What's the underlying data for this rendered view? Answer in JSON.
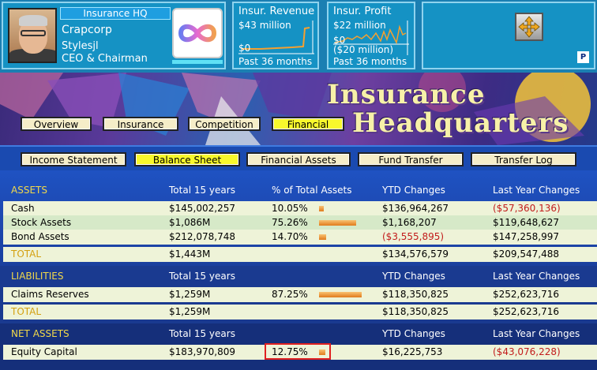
{
  "header": {
    "hq_label": "Insurance HQ",
    "company_name": "Crapcorp",
    "user_name": "Stylesjl",
    "user_title": "CEO & Chairman"
  },
  "revenue_graph": {
    "title": "Insur. Revenue",
    "top_value": "$43 million",
    "bottom_value": "$0",
    "footer": "Past 36 months"
  },
  "profit_graph": {
    "title": "Insur. Profit",
    "top_value": "$22 million",
    "mid_value": "$0",
    "bottom_value": "($20 million)",
    "footer": "Past 36 months"
  },
  "tools": {
    "badge": "P"
  },
  "banner": {
    "title_line1": "Insurance",
    "title_line2": "Headquarters"
  },
  "nav_tabs": [
    {
      "label": "Overview",
      "active": false
    },
    {
      "label": "Insurance",
      "active": false
    },
    {
      "label": "Competition",
      "active": false
    },
    {
      "label": "Financial",
      "active": true
    }
  ],
  "sub_tabs": [
    {
      "label": "Income Statement",
      "active": false
    },
    {
      "label": "Balance Sheet",
      "active": true
    },
    {
      "label": "Financial Assets",
      "active": false
    },
    {
      "label": "Fund Transfer",
      "active": false
    },
    {
      "label": "Transfer Log",
      "active": false
    }
  ],
  "assets": {
    "header": [
      "ASSETS",
      "Total 15 years",
      "% of Total Assets",
      "YTD Changes",
      "Last Year Changes"
    ],
    "rows": [
      {
        "name": "Cash",
        "total": "$145,002,257",
        "pct": "10.05%",
        "pct_value": 10.05,
        "ytd": "$136,964,267",
        "last": "($57,360,136)"
      },
      {
        "name": "Stock Assets",
        "total": "$1,086M",
        "pct": "75.26%",
        "pct_value": 75.26,
        "ytd": "$1,168,207",
        "last": "$119,648,627"
      },
      {
        "name": "Bond Assets",
        "total": "$212,078,748",
        "pct": "14.70%",
        "pct_value": 14.7,
        "ytd": "($3,555,895)",
        "last": "$147,258,997"
      }
    ],
    "total": {
      "name": "TOTAL",
      "total": "$1,443M",
      "ytd": "$134,576,579",
      "last": "$209,547,488"
    }
  },
  "liabilities": {
    "header": [
      "LIABILITIES",
      "Total 15 years",
      "YTD Changes",
      "Last Year Changes"
    ],
    "rows": [
      {
        "name": "Claims Reserves",
        "total": "$1,259M",
        "pct": "87.25%",
        "pct_value": 87.25,
        "ytd": "$118,350,825",
        "last": "$252,623,716"
      }
    ],
    "total": {
      "name": "TOTAL",
      "total": "$1,259M",
      "ytd": "$118,350,825",
      "last": "$252,623,716"
    }
  },
  "net_assets": {
    "header": [
      "NET ASSETS",
      "Total 15 years",
      "YTD Changes",
      "Last Year Changes"
    ],
    "rows": [
      {
        "name": "Equity Capital",
        "total": "$183,970,809",
        "pct": "12.75%",
        "pct_value": 12.75,
        "ytd": "$16,225,753",
        "last": "($43,076,228)"
      }
    ]
  },
  "colors": {
    "accent": "#f8f82c",
    "negative": "#c21b1b",
    "section": "#f2d94a"
  }
}
